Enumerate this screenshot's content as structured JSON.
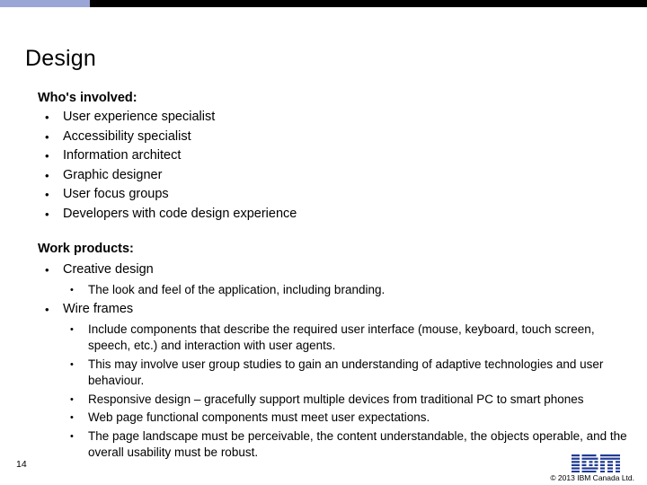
{
  "slide": {
    "title": "Design",
    "page_number": "14",
    "copyright": "© 2013 IBM Canada Ltd.",
    "logo_name": "IBM",
    "colors": {
      "topbar_left": "#9aa7d6",
      "topbar_right": "#000000",
      "text": "#000000",
      "background": "#ffffff"
    },
    "sections": [
      {
        "heading": "Who's involved:",
        "items": [
          "User experience specialist",
          "Accessibility specialist",
          "Information architect",
          "Graphic designer",
          "User focus groups",
          "Developers with code design experience"
        ]
      },
      {
        "heading": "Work products:",
        "groups": [
          {
            "label": "Creative design",
            "subitems": [
              "The look and feel of the application, including branding."
            ]
          },
          {
            "label": "Wire frames",
            "subitems": [
              "Include components that describe the required user interface (mouse, keyboard, touch screen, speech, etc.) and interaction with user agents.",
              "This may involve user group studies to gain an understanding of adaptive technologies and user behaviour.",
              "Responsive design – gracefully support multiple devices from traditional PC to smart phones",
              "Web page functional components must meet user expectations.",
              "The page landscape must be perceivable, the content understandable, the objects operable, and the overall usability must be robust."
            ]
          }
        ]
      }
    ],
    "bullet_glyph": "•"
  }
}
